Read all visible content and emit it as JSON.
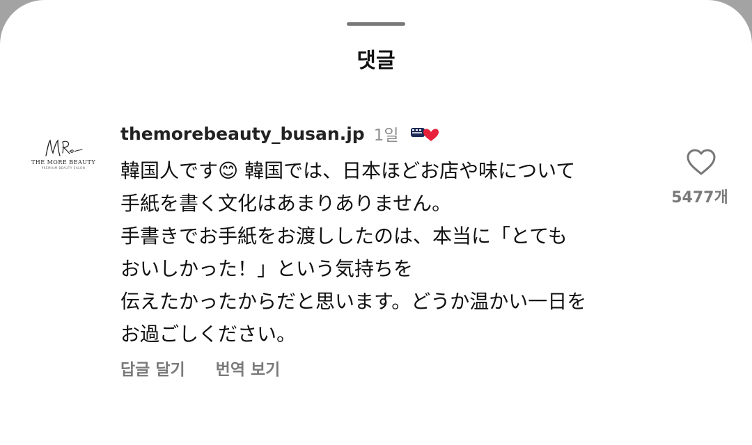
{
  "sheet": {
    "title": "댓글"
  },
  "comment": {
    "username": "themorebeauty_busan.jp",
    "time": "1일",
    "author_liked_icon": "heart-with-avatar-icon",
    "avatar": {
      "brand": "THE MORE BEAUTY",
      "subtitle": "PREMIUM BEAUTY SALON"
    },
    "lines": [
      "韓国人です😊 韓国では、日本ほどお店や味について",
      "手紙を書く文化はあまりありません。",
      "手書きでお手紙をお渡ししたのは、本当に「とても",
      "おいしかった！」という気持ちを",
      "伝えたかったからだと思います。どうか温かい一日を",
      "お過ごしください。"
    ],
    "actions": {
      "reply": "답글 달기",
      "translate": "번역 보기"
    },
    "like_count": "5477개"
  },
  "colors": {
    "backdrop": "#a3a3a3",
    "sheet": "#ffffff",
    "text": "#111111",
    "muted": "#7a7a7a",
    "heart_red": "#e8213a"
  }
}
